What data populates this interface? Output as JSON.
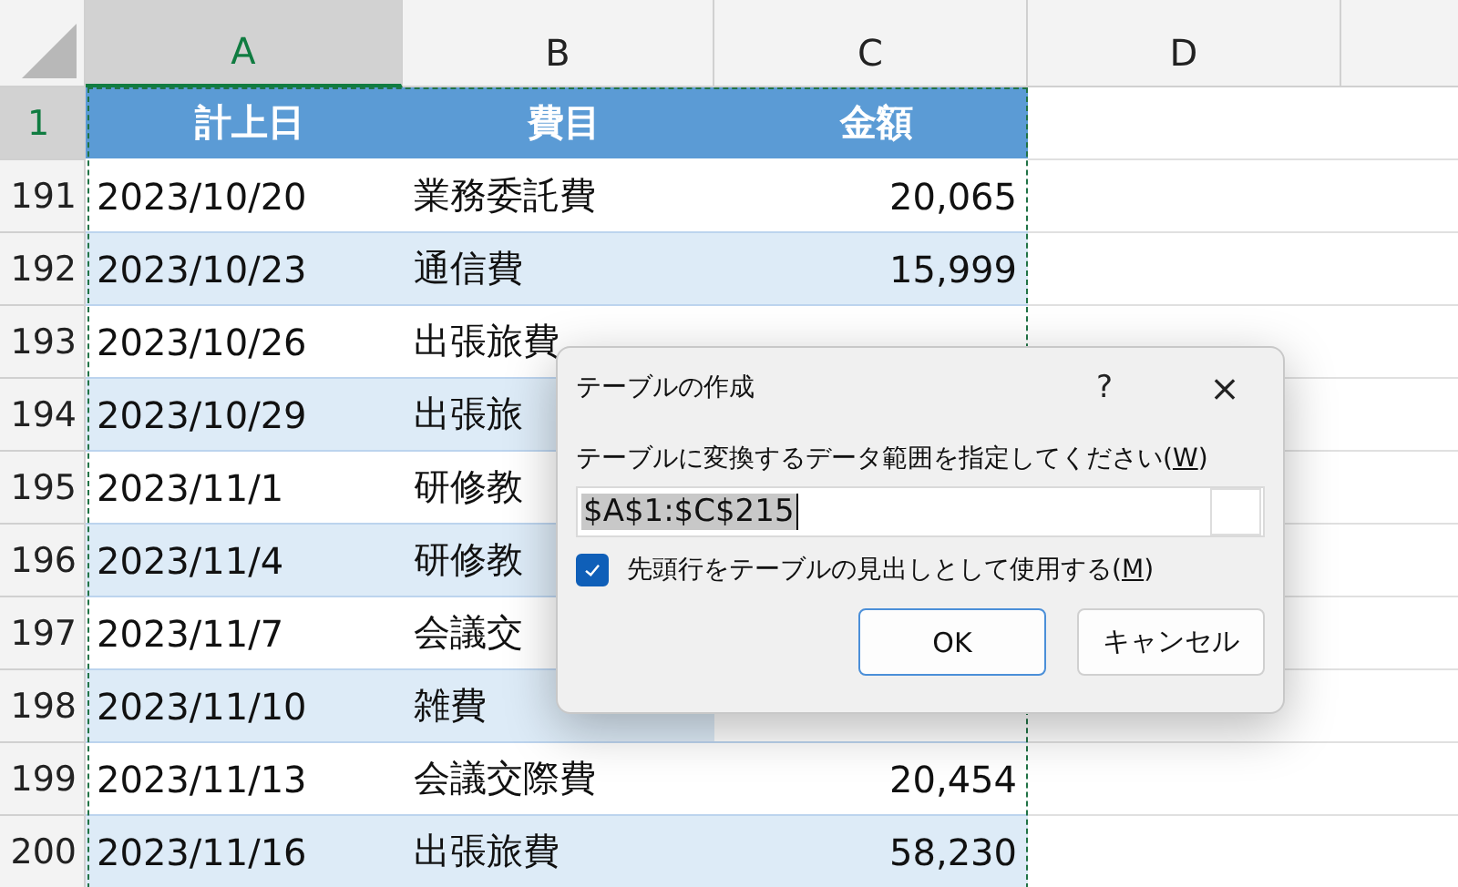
{
  "columns": [
    {
      "label": "A",
      "selected": true
    },
    {
      "label": "B",
      "selected": false
    },
    {
      "label": "C",
      "selected": false
    },
    {
      "label": "D",
      "selected": false
    }
  ],
  "header_row": {
    "number": "1",
    "cells": [
      "計上日",
      "費目",
      "金額"
    ]
  },
  "rows": [
    {
      "number": "191",
      "date": "2023/10/20",
      "item": "業務委託費",
      "amount": "20,065"
    },
    {
      "number": "192",
      "date": "2023/10/23",
      "item": "通信費",
      "amount": "15,999"
    },
    {
      "number": "193",
      "date": "2023/10/26",
      "item": "出張旅費"
    },
    {
      "number": "194",
      "date": "2023/10/29",
      "item": "出張旅"
    },
    {
      "number": "195",
      "date": "2023/11/1",
      "item": "研修教"
    },
    {
      "number": "196",
      "date": "2023/11/4",
      "item": "研修教"
    },
    {
      "number": "197",
      "date": "2023/11/7",
      "item": "会議交"
    },
    {
      "number": "198",
      "date": "2023/11/10",
      "item": "雑費"
    },
    {
      "number": "199",
      "date": "2023/11/13",
      "item": "会議交際費",
      "amount": "20,454"
    },
    {
      "number": "200",
      "date": "2023/11/16",
      "item": "出張旅費",
      "amount": "58,230"
    }
  ],
  "dialog": {
    "title": "テーブルの作成",
    "help": "?",
    "close": "×",
    "range_label": {
      "before": "テーブルに変換するデータ範囲を指定してください(",
      "access_key": "W",
      "after": ")"
    },
    "range_value": "$A$1:$C$215",
    "header_checkbox": {
      "before": "先頭行をテーブルの見出しとして使用する(",
      "access_key": "M",
      "after": ")",
      "checked": true
    },
    "buttons": [
      {
        "label": "OK",
        "default": true
      },
      {
        "label": "キャンセル",
        "default": false
      }
    ]
  }
}
